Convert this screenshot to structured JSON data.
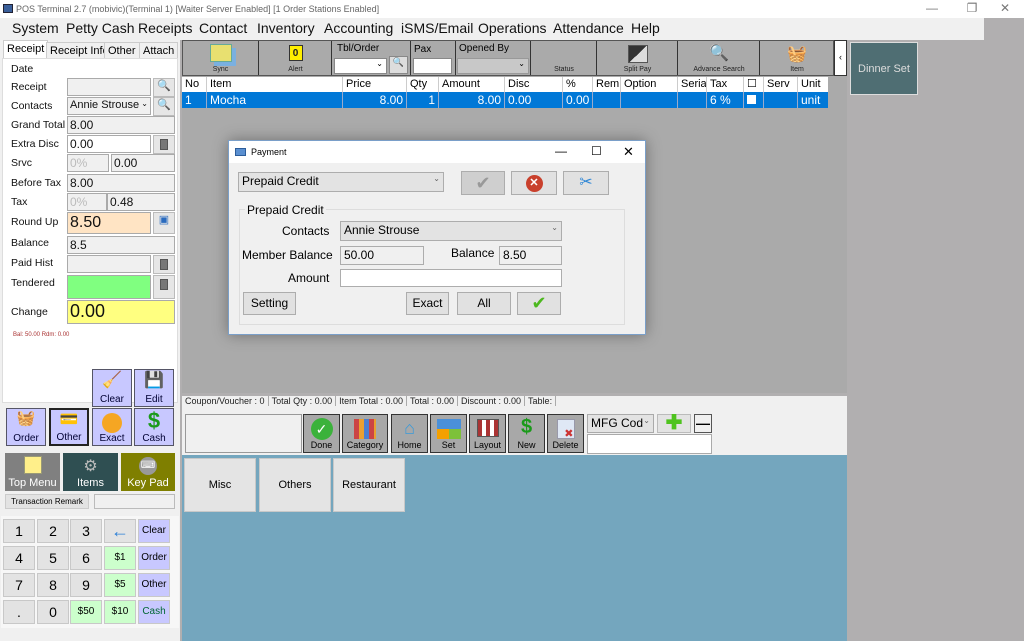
{
  "window": {
    "title": "POS Terminal 2.7 (mobivic)(Terminal 1) [Waiter Server Enabled] [1 Order Stations Enabled]"
  },
  "menu": [
    "System",
    "Petty Cash",
    "Receipts",
    "Contact",
    "Inventory",
    "Accounting",
    "iSMS/Email",
    "Operations",
    "Attendance",
    "Help"
  ],
  "left_tabs": [
    "Receipt",
    "Receipt Info",
    "Other",
    "Attach"
  ],
  "receipt": {
    "date_label": "Date",
    "receipt_label": "Receipt",
    "receipt_value": "",
    "contacts_label": "Contacts",
    "contacts_value": "Annie Strouse",
    "grand_total_label": "Grand Total",
    "grand_total_value": "8.00",
    "extra_disc_label": "Extra Disc",
    "extra_disc_value": "0.00",
    "srvc_label": "Srvc",
    "srvc_pct": "0%",
    "srvc_value": "0.00",
    "before_tax_label": "Before Tax",
    "before_tax_value": "8.00",
    "tax_label": "Tax",
    "tax_pct": "0%",
    "tax_value": "0.48",
    "round_up_label": "Round Up",
    "round_up_value": "8.50",
    "balance_label": "Balance",
    "balance_value": "8.5",
    "paid_hist_label": "Paid Hist",
    "paid_hist_value": "",
    "tendered_label": "Tendered",
    "tendered_value": "",
    "change_label": "Change",
    "change_value": "0.00",
    "bal_note": "Bal: 50.00 Rdm: 0.00"
  },
  "pay_buttons": {
    "clear": "Clear",
    "edit": "Edit",
    "order": "Order",
    "other": "Other",
    "exact": "Exact",
    "cash": "Cash"
  },
  "nav_buttons": {
    "top_menu": "Top Menu",
    "items": "Items",
    "key_pad": "Key Pad"
  },
  "transaction_remark": {
    "label": "Transaction Remark",
    "value": ""
  },
  "keypad": [
    [
      "1",
      "2",
      "3",
      "←",
      "Clear"
    ],
    [
      "4",
      "5",
      "6",
      "$1",
      "Order"
    ],
    [
      "7",
      "8",
      "9",
      "$5",
      "Other"
    ],
    [
      ".",
      "0",
      "$50",
      "$10",
      "Cash"
    ]
  ],
  "toolbar": {
    "sync": "Sync",
    "alert": "Alert",
    "alert_count": "0",
    "tbl_order": "Tbl/Order",
    "tbl_order_value": "",
    "pax": "Pax",
    "pax_value": "",
    "opened_by": "Opened By",
    "opened_by_value": "",
    "status": "Status",
    "split_pay": "Split Pay",
    "advance_search": "Advance Search",
    "item": "Item",
    "collapse": "‹"
  },
  "grid": {
    "columns": [
      "No",
      "Item",
      "Price",
      "Qty",
      "Amount",
      "Disc",
      "%",
      "Rem",
      "Option",
      "Serial",
      "Tax",
      "☐",
      "Serv",
      "Unit"
    ],
    "rows": [
      {
        "no": "1",
        "item": "Mocha",
        "price": "8.00",
        "qty": "1",
        "amount": "8.00",
        "disc": "0.00",
        "pct": "0.00",
        "rem": "",
        "option": "",
        "serial": "",
        "tax": "6 %",
        "check": false,
        "serv": "",
        "unit": "unit"
      }
    ]
  },
  "status": {
    "coupon": "Coupon/Voucher :  0",
    "total_qty": "Total Qty :  0.00",
    "item_total": "Item Total :  0.00",
    "total": "Total :  0.00",
    "discount": "Discount :  0.00",
    "table": "Table:"
  },
  "actions": [
    "Done",
    "Category",
    "Home",
    "Set",
    "Layout",
    "New",
    "Delete"
  ],
  "mfg": {
    "selected": "MFG Cod",
    "value": ""
  },
  "categories": [
    "Misc",
    "Others",
    "Restaurant"
  ],
  "right_tiles": [
    "Dinner Set"
  ],
  "dialog": {
    "title": "Payment",
    "method": "Prepaid Credit",
    "group_title": "Prepaid Credit",
    "contacts_label": "Contacts",
    "contacts_value": "Annie Strouse",
    "member_balance_label": "Member Balance",
    "member_balance_value": "50.00",
    "balance_label": "Balance",
    "balance_value": "8.50",
    "amount_label": "Amount",
    "amount_value": "",
    "setting": "Setting",
    "exact": "Exact",
    "all": "All"
  },
  "colors": {
    "selection": "#0078d7",
    "round_up_bg": "#ffe4c4",
    "tendered_bg": "#80ff80",
    "change_bg": "#ffff80",
    "category_bg": "#74a6be",
    "dinner_tile": "#4f6e73"
  }
}
